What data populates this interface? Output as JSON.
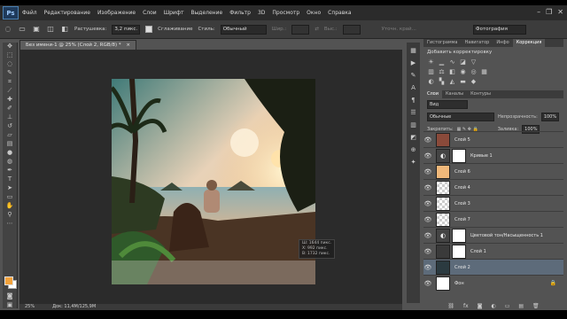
{
  "menubar": {
    "logo": "Ps",
    "items": [
      "Файл",
      "Редактирование",
      "Изображение",
      "Слои",
      "Шрифт",
      "Выделение",
      "Фильтр",
      "3D",
      "Просмотр",
      "Окно",
      "Справка"
    ]
  },
  "options": {
    "feather_label": "Растушевка:",
    "feather_value": "3,2 пикс.",
    "antialias_label": "Сглаживание",
    "style_label": "Стиль:",
    "style_value": "Обычный",
    "width_label": "Шир.:",
    "height_label": "Выс.:",
    "refine_label": "Уточн. край...",
    "workspace_value": "Фотография"
  },
  "document": {
    "tab_title": "Без имени-1 @ 25% (Слой 2, RGB/8) *",
    "zoom": "25%",
    "doc_size": "Док: 11,4M/125,9M"
  },
  "hud": {
    "line1": "Ш: 1644 пикс.",
    "line2": "X: 992 пикс.",
    "line3": "В: 1732 пикс."
  },
  "panels": {
    "tabs": [
      "Гистограмма",
      "Навигатор",
      "Инфо",
      "Коррекция"
    ],
    "active_tab": "Коррекция",
    "adj_title": "Добавить корректировку",
    "layer_tabs": [
      "Слои",
      "Каналы",
      "Контуры"
    ],
    "kind_label": "Вид",
    "blend_mode": "Обычные",
    "opacity_label": "Непрозрачность:",
    "opacity_value": "100%",
    "lock_label": "Закрепить:",
    "fill_label": "Заливка:",
    "fill_value": "100%"
  },
  "layers": [
    {
      "name": "Слой 5",
      "thumb": "#8a4a3a",
      "mask": false,
      "selected": false
    },
    {
      "name": "Кривые 1",
      "thumb": "adj",
      "mask": true,
      "selected": false
    },
    {
      "name": "Слой 6",
      "thumb": "#f0b87a",
      "mask": false,
      "selected": false
    },
    {
      "name": "Слой 4",
      "thumb": "checker",
      "mask": false,
      "selected": false
    },
    {
      "name": "Слой 3",
      "thumb": "checker",
      "mask": false,
      "selected": false
    },
    {
      "name": "Слой 7",
      "thumb": "checker",
      "mask": false,
      "selected": false
    },
    {
      "name": "Цветовой тон/Насыщенность 1",
      "thumb": "adj",
      "mask": true,
      "selected": false
    },
    {
      "name": "Слой 1",
      "thumb": "#3a3a3a",
      "mask": true,
      "selected": false
    },
    {
      "name": "Слой 2",
      "thumb": "#2b3a40",
      "mask": false,
      "selected": true
    },
    {
      "name": "Фон",
      "thumb": "#ffffff",
      "mask": false,
      "selected": false
    }
  ],
  "colors": {
    "foreground": "#f2a23c",
    "background": "#ffffff"
  }
}
